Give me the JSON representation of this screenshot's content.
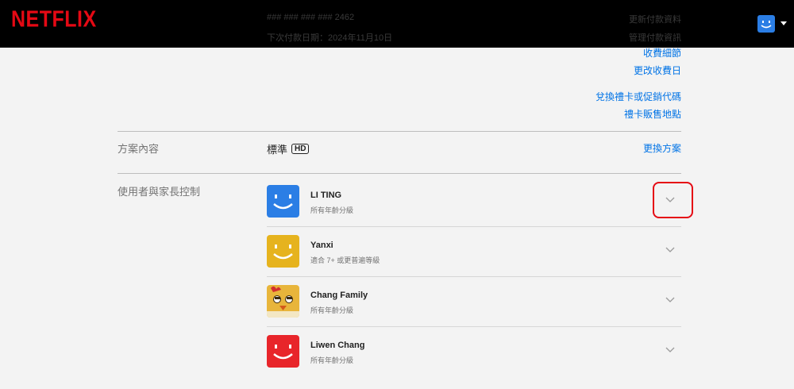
{
  "header": {
    "logo": "NETFLIX",
    "ghost_line_1": "### ### ### ### 2462",
    "ghost_line_2": "下次付款日期：2024年11月10日",
    "ghost_link_1": "更新付款資料",
    "ghost_link_2": "管理付款資訊"
  },
  "billing": {
    "links": [
      "收費細節",
      "更改收費日",
      "兌換禮卡或促銷代碼",
      "禮卡販售地點"
    ]
  },
  "plan": {
    "label": "方案內容",
    "name": "標準",
    "badge": "HD",
    "change_link": "更換方案"
  },
  "profiles": {
    "label": "使用者與家長控制",
    "items": [
      {
        "name": "LI TING",
        "rating": "所有年齡分級",
        "color": "#2b7ee5"
      },
      {
        "name": "Yanxi",
        "rating": "適合 7+ 或更普遍等級",
        "color": "#e6b31e"
      },
      {
        "name": "Chang Family",
        "rating": "所有年齡分級",
        "color": "#e8b53b"
      },
      {
        "name": "Liwen Chang",
        "rating": "所有年齡分級",
        "color": "#e8252a"
      }
    ]
  },
  "colors": {
    "brand": "#e50914",
    "link": "#0073e6"
  },
  "icons": {
    "chevron": "chevron-down-icon",
    "caret": "caret-down-icon"
  }
}
